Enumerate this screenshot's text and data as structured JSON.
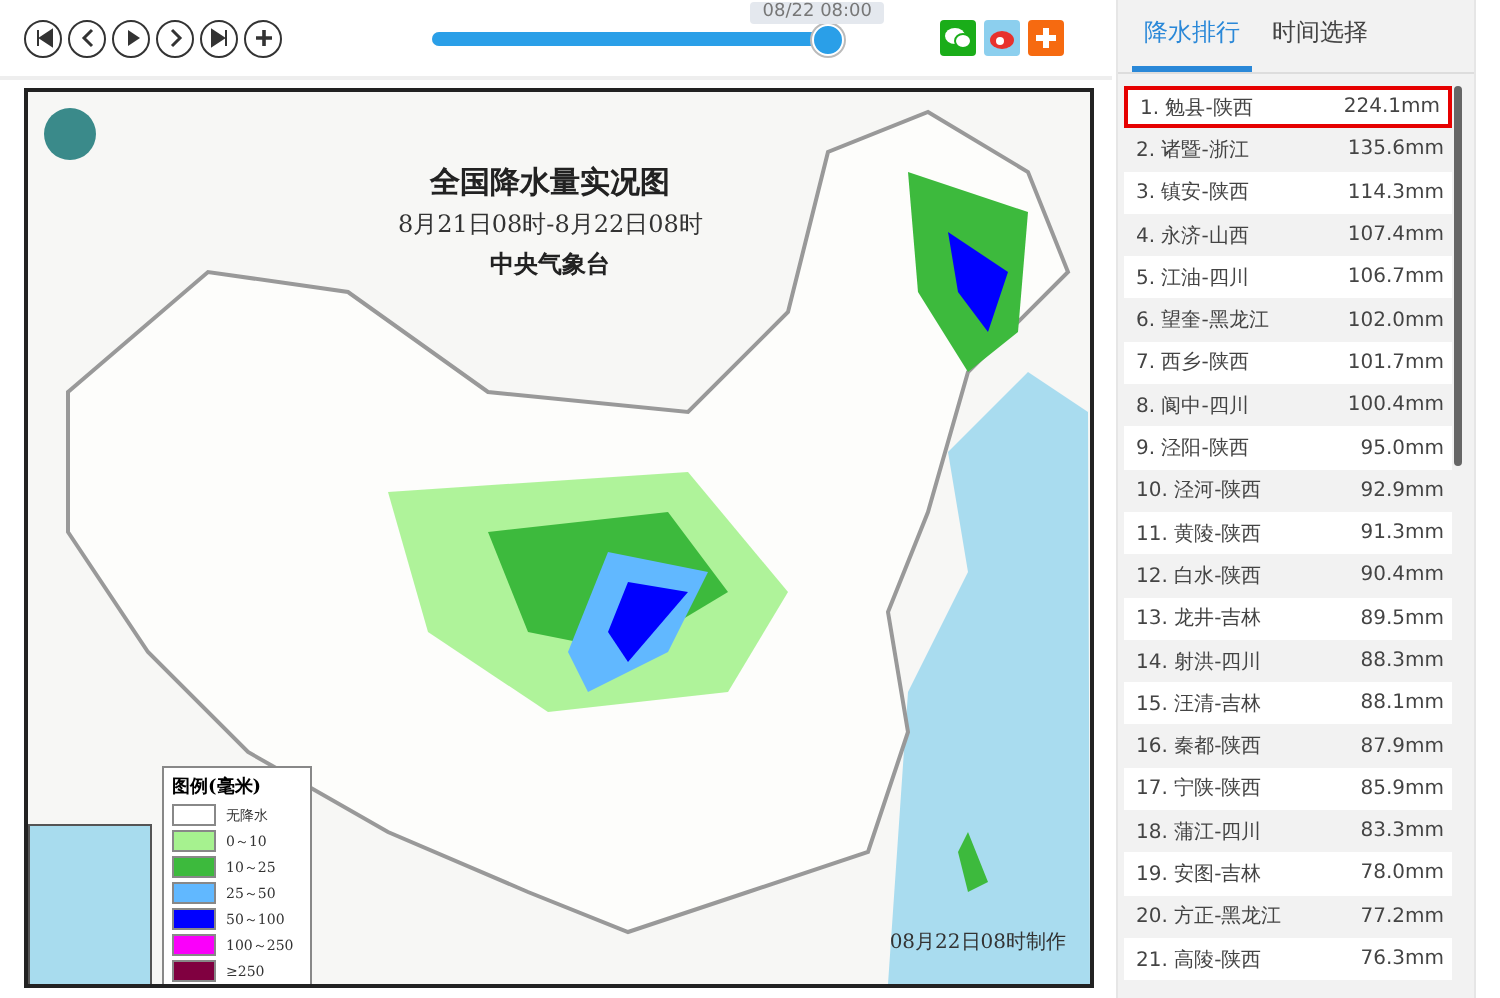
{
  "toolbar": {
    "slider": {
      "level": 1.0,
      "tooltip": "08/22 08:00"
    }
  },
  "map": {
    "title": "全国降水量实况图",
    "period": "8月21日08时-8月22日08时",
    "agency": "中央气象台",
    "stamp": "08月22日08时制作",
    "legend": {
      "title": "图例(毫米)",
      "items": [
        {
          "label": "无降水",
          "color": "#ffffff"
        },
        {
          "label": "0～10",
          "color": "#a6f28f"
        },
        {
          "label": "10～25",
          "color": "#3dba3d"
        },
        {
          "label": "25～50",
          "color": "#61b8ff"
        },
        {
          "label": "50～100",
          "color": "#0000ff"
        },
        {
          "label": "100～250",
          "color": "#fa00fa"
        },
        {
          "label": "≥250",
          "color": "#800040"
        }
      ]
    }
  },
  "tabs": [
    {
      "label": "降水排行",
      "selected": true
    },
    {
      "label": "时间选择",
      "selected": false
    }
  ],
  "ranking": [
    {
      "name": "1. 勉县-陕西",
      "value": "224.1mm",
      "selected": true
    },
    {
      "name": "2. 诸暨-浙江",
      "value": "135.6mm",
      "selected": false
    },
    {
      "name": "3. 镇安-陕西",
      "value": "114.3mm",
      "selected": false
    },
    {
      "name": "4. 永济-山西",
      "value": "107.4mm",
      "selected": false
    },
    {
      "name": "5. 江油-四川",
      "value": "106.7mm",
      "selected": false
    },
    {
      "name": "6. 望奎-黑龙江",
      "value": "102.0mm",
      "selected": false
    },
    {
      "name": "7. 西乡-陕西",
      "value": "101.7mm",
      "selected": false
    },
    {
      "name": "8. 阆中-四川",
      "value": "100.4mm",
      "selected": false
    },
    {
      "name": "9. 泾阳-陕西",
      "value": "95.0mm",
      "selected": false
    },
    {
      "name": "10. 泾河-陕西",
      "value": "92.9mm",
      "selected": false
    },
    {
      "name": "11. 黄陵-陕西",
      "value": "91.3mm",
      "selected": false
    },
    {
      "name": "12. 白水-陕西",
      "value": "90.4mm",
      "selected": false
    },
    {
      "name": "13. 龙井-吉林",
      "value": "89.5mm",
      "selected": false
    },
    {
      "name": "14. 射洪-四川",
      "value": "88.3mm",
      "selected": false
    },
    {
      "name": "15. 汪清-吉林",
      "value": "88.1mm",
      "selected": false
    },
    {
      "name": "16. 秦都-陕西",
      "value": "87.9mm",
      "selected": false
    },
    {
      "name": "17. 宁陕-陕西",
      "value": "85.9mm",
      "selected": false
    },
    {
      "name": "18. 蒲江-四川",
      "value": "83.3mm",
      "selected": false
    },
    {
      "name": "19. 安图-吉林",
      "value": "78.0mm",
      "selected": false
    },
    {
      "name": "20. 方正-黑龙江",
      "value": "77.2mm",
      "selected": false
    },
    {
      "name": "21. 高陵-陕西",
      "value": "76.3mm",
      "selected": false
    }
  ]
}
